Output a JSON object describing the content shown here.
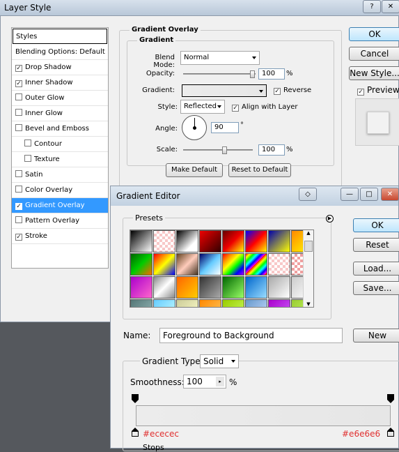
{
  "layer_style": {
    "title": "Layer Style",
    "styles_header": "Styles",
    "items": [
      {
        "label": "Blending Options: Default",
        "checkbox": false,
        "checked": false,
        "sub": false,
        "active": false
      },
      {
        "label": "Drop Shadow",
        "checkbox": true,
        "checked": true,
        "sub": false,
        "active": false
      },
      {
        "label": "Inner Shadow",
        "checkbox": true,
        "checked": true,
        "sub": false,
        "active": false
      },
      {
        "label": "Outer Glow",
        "checkbox": true,
        "checked": false,
        "sub": false,
        "active": false
      },
      {
        "label": "Inner Glow",
        "checkbox": true,
        "checked": false,
        "sub": false,
        "active": false
      },
      {
        "label": "Bevel and Emboss",
        "checkbox": true,
        "checked": false,
        "sub": false,
        "active": false
      },
      {
        "label": "Contour",
        "checkbox": true,
        "checked": false,
        "sub": true,
        "active": false
      },
      {
        "label": "Texture",
        "checkbox": true,
        "checked": false,
        "sub": true,
        "active": false
      },
      {
        "label": "Satin",
        "checkbox": true,
        "checked": false,
        "sub": false,
        "active": false
      },
      {
        "label": "Color Overlay",
        "checkbox": true,
        "checked": false,
        "sub": false,
        "active": false
      },
      {
        "label": "Gradient Overlay",
        "checkbox": true,
        "checked": true,
        "sub": false,
        "active": true
      },
      {
        "label": "Pattern Overlay",
        "checkbox": true,
        "checked": false,
        "sub": false,
        "active": false
      },
      {
        "label": "Stroke",
        "checkbox": true,
        "checked": true,
        "sub": false,
        "active": false
      }
    ],
    "panel_title": "Gradient Overlay",
    "group_title": "Gradient",
    "blend_mode_label": "Blend Mode:",
    "blend_mode_value": "Normal",
    "opacity_label": "Opacity:",
    "opacity_value": "100",
    "percent": "%",
    "gradient_label": "Gradient:",
    "reverse_label": "Reverse",
    "reverse_checked": true,
    "style_label": "Style:",
    "style_value": "Reflected",
    "align_label": "Align with Layer",
    "align_checked": true,
    "angle_label": "Angle:",
    "angle_value": "90",
    "degree": "°",
    "scale_label": "Scale:",
    "scale_value": "100",
    "make_default": "Make Default",
    "reset_default": "Reset to Default",
    "ok": "OK",
    "cancel": "Cancel",
    "new_style": "New Style...",
    "preview_label": "Preview",
    "preview_checked": true
  },
  "gradient_editor": {
    "title": "Gradient Editor",
    "presets_label": "Presets",
    "ok": "OK",
    "reset": "Reset",
    "load": "Load...",
    "save": "Save...",
    "name_label": "Name:",
    "name_value": "Foreground to Background",
    "new_button": "New",
    "gradient_type_label": "Gradient Type:",
    "gradient_type_value": "Solid",
    "smoothness_label": "Smoothness:",
    "smoothness_value": "100",
    "percent": "%",
    "stop_left_color": "#ececec",
    "stop_right_color": "#e6e6e6",
    "stops_label": "Stops"
  },
  "swatches": [
    "linear-gradient(135deg,#000,#fff)",
    "repeating-conic-gradient(#f8c8c8 0% 25%, #fff 0% 50%) 0 0/8px 8px",
    "linear-gradient(135deg,#000,#fff 70%)",
    "linear-gradient(135deg,#e00,#300)",
    "linear-gradient(135deg,#600,#e00,#ff0)",
    "linear-gradient(135deg,#00f,#f00,#ff0)",
    "linear-gradient(135deg,#00a,#ff0)",
    "linear-gradient(135deg,#f80,#ff0)",
    "linear-gradient(135deg,#060,#0c0,#f60)",
    "linear-gradient(135deg,#f00,#ff0,#00f)",
    "linear-gradient(135deg,#642,#fcb,#432)",
    "linear-gradient(135deg,#006,#6cf,#fff)",
    "linear-gradient(135deg,#f00,#f80,#ff0,#0f0,#00f,#a0f)",
    "repeating-linear-gradient(135deg,#f00,#ff0 4px,#0f0 8px,#0ff 12px,#00f 16px,#f0f 20px)",
    "repeating-conic-gradient(#f8c8c8 0% 25%, #fff 0% 50%) 0 0/8px 8px",
    "repeating-conic-gradient(#f0a0a0 0% 25%, #fff 0% 50%) 0 0/8px 8px",
    "linear-gradient(135deg,#a0c,#f6c)",
    "linear-gradient(135deg,#888,#fff,#888)",
    "linear-gradient(135deg,#f60,#fc0)",
    "linear-gradient(135deg,#333,#aaa)",
    "linear-gradient(135deg,#060,#9f6)",
    "linear-gradient(135deg,#06c,#9df)",
    "linear-gradient(135deg,#aaa,#fff)",
    "linear-gradient(135deg,#ccc,#fff)",
    "linear-gradient(135deg,#577,#9bb)",
    "linear-gradient(135deg,#6cf,#cff)",
    "linear-gradient(135deg,#cc9,#ffc)",
    "linear-gradient(135deg,#f80,#fc6)",
    "linear-gradient(135deg,#9c0,#cf6)",
    "linear-gradient(135deg,#69c,#cdf)",
    "linear-gradient(135deg,#a0c,#c6f)",
    "linear-gradient(135deg,#9c3,#cf6)"
  ]
}
